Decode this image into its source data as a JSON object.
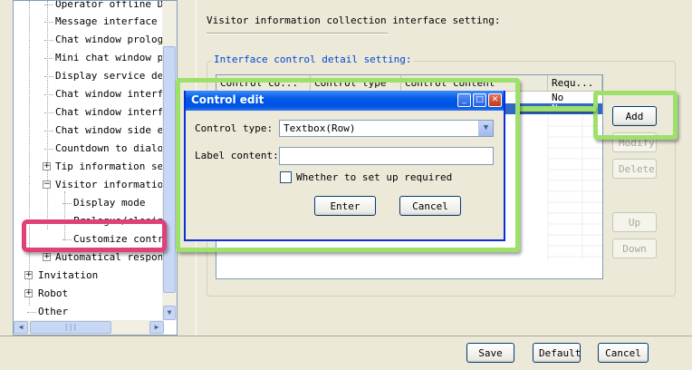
{
  "tree": {
    "items": [
      {
        "label": "Operator offline Dis"
      },
      {
        "label": "Message interface se"
      },
      {
        "label": "Chat window prologue"
      },
      {
        "label": "Mini chat window pro"
      },
      {
        "label": "Display service depa"
      },
      {
        "label": "Chat window interfac"
      },
      {
        "label": "Chat window interfac"
      },
      {
        "label": "Chat window side edg"
      },
      {
        "label": "Countdown to dialog"
      },
      {
        "label": "Tip information sett"
      },
      {
        "label": "Visitor information"
      },
      {
        "label": "Display mode"
      },
      {
        "label": "Prologue/closing"
      },
      {
        "label": "Customize control"
      },
      {
        "label": "Automatical response"
      },
      {
        "label": "Invitation"
      },
      {
        "label": "Robot"
      },
      {
        "label": "Other"
      }
    ],
    "expand_plus": "+",
    "expand_minus": "−"
  },
  "main": {
    "section_title": "Visitor information collection interface setting:",
    "group_legend": "Interface control detail setting:",
    "table": {
      "columns": [
        "Control co...",
        "Control type",
        "Control content",
        "Requ..."
      ],
      "rows": [
        {
          "cells": [
            "",
            "",
            "",
            "No"
          ]
        },
        {
          "cells": [
            "",
            "",
            "",
            "No"
          ]
        }
      ]
    },
    "side_buttons": {
      "add": "Add",
      "modify": "Modify",
      "delete": "Delete",
      "up": "Up",
      "down": "Down"
    }
  },
  "dialog": {
    "title": "Control edit",
    "control_type_label": "Control type:",
    "control_type_value": "Textbox(Row)",
    "label_content_label": "Label content:",
    "label_content_value": "",
    "required_label": "Whether to set up required",
    "enter": "Enter",
    "cancel": "Cancel"
  },
  "footer": {
    "save": "Save",
    "default": "Default",
    "cancel": "Cancel"
  },
  "colors": {
    "highlight_green": "#9de06a",
    "highlight_pink": "#e0407a",
    "titlebar_blue": "#0054e3",
    "selection_blue": "#316ac5"
  }
}
